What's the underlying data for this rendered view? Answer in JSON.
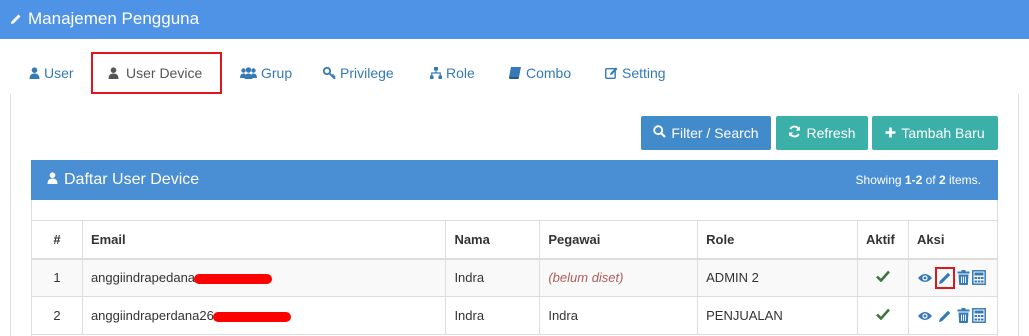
{
  "header": {
    "title": "Manajemen Pengguna",
    "icon": "pencil-icon"
  },
  "tabs": [
    {
      "label": "User",
      "icon": "user-icon"
    },
    {
      "label": "User Device",
      "icon": "user-icon"
    },
    {
      "label": "Grup",
      "icon": "users-icon"
    },
    {
      "label": "Privilege",
      "icon": "key-icon"
    },
    {
      "label": "Role",
      "icon": "sitemap-icon"
    },
    {
      "label": "Combo",
      "icon": "book-icon"
    },
    {
      "label": "Setting",
      "icon": "edit-icon"
    }
  ],
  "toolbar": {
    "filter_label": "Filter / Search",
    "refresh_label": "Refresh",
    "add_label": "Tambah Baru"
  },
  "panel": {
    "title": "Daftar User Device",
    "summary_prefix": "Showing",
    "summary_range": "1-2",
    "summary_of": "of",
    "summary_total": "2",
    "summary_suffix": "items."
  },
  "table": {
    "headers": [
      "#",
      "Email",
      "Nama",
      "Pegawai",
      "Role",
      "Aktif",
      "Aksi"
    ],
    "rows": [
      {
        "num": "1",
        "email": "anggiindrapedana",
        "nama": "Indra",
        "pegawai": "(belum diset)",
        "role": "ADMIN 2",
        "aktif": "check-icon"
      },
      {
        "num": "2",
        "email": "anggiindraperdana26",
        "nama": "Indra",
        "pegawai": "Indra",
        "role": "PENJUALAN",
        "aktif": "check-icon"
      }
    ]
  },
  "colors": {
    "header_bg": "#4f93e6",
    "panel_bg": "#4a8ed4",
    "primary": "#428bca",
    "teal": "#3ab0a9",
    "link": "#337ab7",
    "highlight": "#e0161e",
    "check": "#3c763d"
  }
}
